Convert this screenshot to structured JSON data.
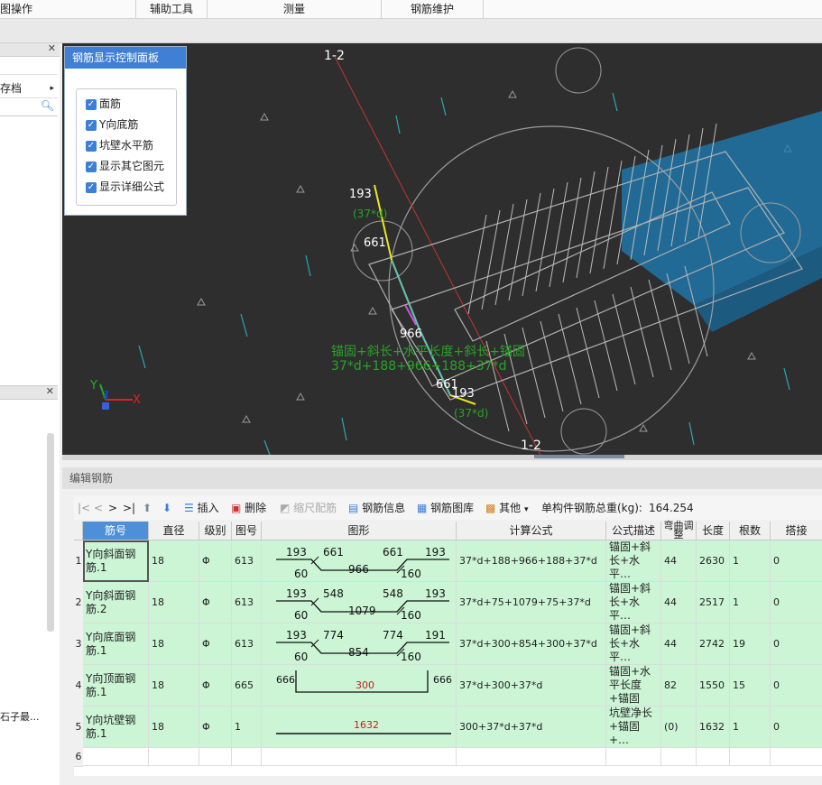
{
  "menu": [
    "图操作",
    "辅助工具",
    "测量",
    "钢筋维护"
  ],
  "left_panel": {
    "doc_label": "存档",
    "truncated_item": "石子最..."
  },
  "control_panel": {
    "title": "钢筋显示控制面板",
    "options": [
      {
        "label": "面筋",
        "checked": true
      },
      {
        "label": "Y向底筋",
        "checked": true
      },
      {
        "label": "坑壁水平筋",
        "checked": true
      },
      {
        "label": "显示其它图元",
        "checked": true
      },
      {
        "label": "显示详细公式",
        "checked": true
      }
    ]
  },
  "viewport": {
    "section_label_top": "1-2",
    "section_label_bottom": "1-2",
    "dims": {
      "d193a": "193",
      "d661a": "661",
      "d37a": "(37*d)",
      "d966": "966",
      "d661b": "661",
      "d193b": "193",
      "d37b": "(37*d)"
    },
    "formula_line1": "锚固+斜长+水平长度+斜长+锚固",
    "formula_line2": "37*d+188+966+188+37*d",
    "axes": {
      "x": "X",
      "y": "Y",
      "z": "Z"
    }
  },
  "editor": {
    "title": "编辑钢筋",
    "toolbar": {
      "nav": [
        "|<",
        "<",
        ">",
        ">|"
      ],
      "insert": "插入",
      "delete": "删除",
      "scale": "缩尺配筋",
      "info": "钢筋信息",
      "library": "钢筋图库",
      "other": "其他",
      "weight_label": "单构件钢筋总重(kg):",
      "weight_value": "164.254"
    },
    "columns": [
      "筋号",
      "直径(mm)",
      "级别",
      "图号",
      "图形",
      "计算公式",
      "公式描述",
      "弯曲调整",
      "长度",
      "根数",
      "搭接"
    ],
    "rows": [
      {
        "no": "1",
        "name": "Y向斜面钢筋.1",
        "dia": "18",
        "grade": "Φ",
        "fig": "613",
        "shape": {
          "a": "193",
          "b": "661",
          "c": "661",
          "d": "193",
          "e": "60",
          "f": "966",
          "g": "160"
        },
        "formula": "37*d+188+966+188+37*d",
        "desc": "锚固+斜长+水平…",
        "bend": "44",
        "len": "2630",
        "count": "1",
        "lap": "0"
      },
      {
        "no": "2",
        "name": "Y向斜面钢筋.2",
        "dia": "18",
        "grade": "Φ",
        "fig": "613",
        "shape": {
          "a": "193",
          "b": "548",
          "c": "548",
          "d": "193",
          "e": "60",
          "f": "1079",
          "g": "160"
        },
        "formula": "37*d+75+1079+75+37*d",
        "desc": "锚固+斜长+水平…",
        "bend": "44",
        "len": "2517",
        "count": "1",
        "lap": "0"
      },
      {
        "no": "3",
        "name": "Y向底面钢筋.1",
        "dia": "18",
        "grade": "Φ",
        "fig": "613",
        "shape": {
          "a": "193",
          "b": "774",
          "c": "774",
          "d": "191",
          "e": "60",
          "f": "854",
          "g": "160"
        },
        "formula": "37*d+300+854+300+37*d",
        "desc": "锚固+斜长+水平…",
        "bend": "44",
        "len": "2742",
        "count": "19",
        "lap": "0"
      },
      {
        "no": "4",
        "name": "Y向顶面钢筋.1",
        "dia": "18",
        "grade": "Φ",
        "fig": "665",
        "shape": {
          "left": "666",
          "mid": "300",
          "right": "666"
        },
        "formula": "37*d+300+37*d",
        "desc": "锚固+水平长度+锚固",
        "bend": "82",
        "len": "1550",
        "count": "15",
        "lap": "0"
      },
      {
        "no": "5",
        "name": "Y向坑壁钢筋.1",
        "dia": "18",
        "grade": "Φ",
        "fig": "1",
        "shape": {
          "mid": "1632"
        },
        "formula": "300+37*d+37*d",
        "desc": "坑壁净长+锚固+…",
        "bend": "(0)",
        "len": "1632",
        "count": "1",
        "lap": "0"
      },
      {
        "no": "6"
      }
    ]
  }
}
